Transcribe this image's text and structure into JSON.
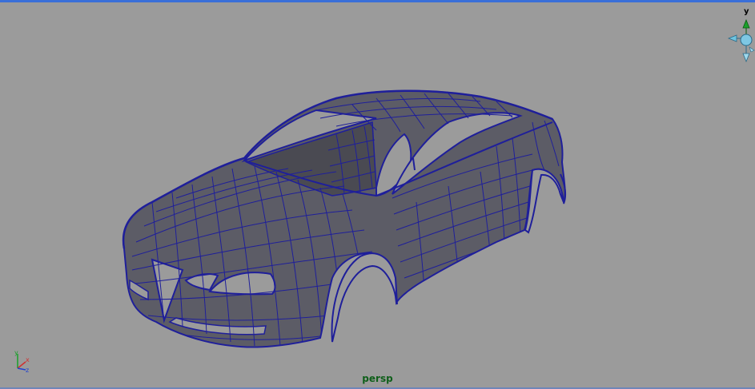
{
  "viewport": {
    "camera_label": "persp",
    "viewcube_axis_label": "y",
    "model_icon": "car-body-wireframe-icon",
    "colors": {
      "background": "#9b9b9b",
      "wire": "#1f1f9a",
      "surface": "#5a5a63",
      "label": "#0f5f1a"
    }
  },
  "axis_gizmo": {
    "x": "x",
    "y": "y",
    "z": "z"
  }
}
